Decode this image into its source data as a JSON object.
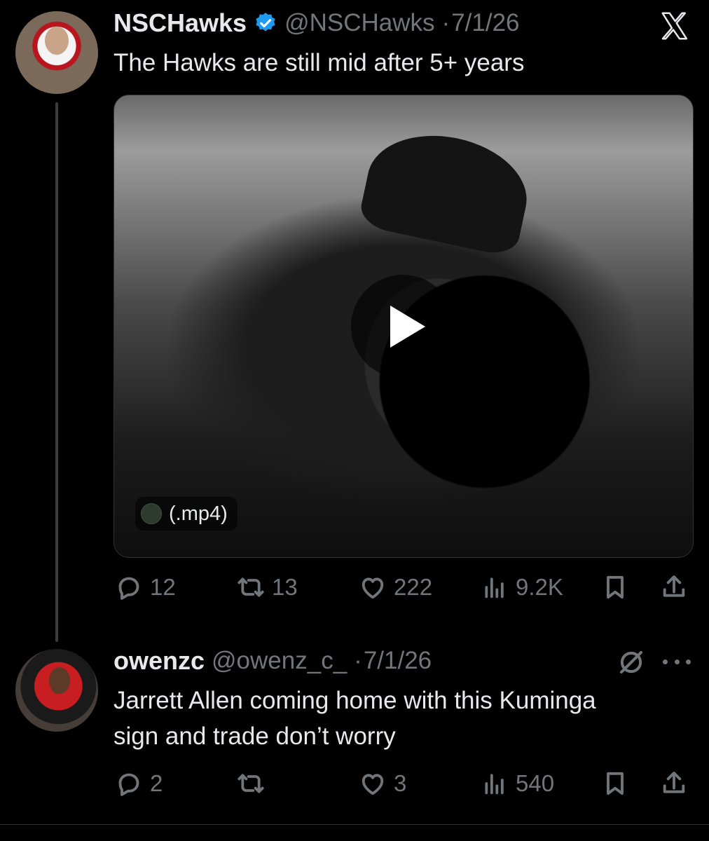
{
  "tweet": {
    "display_name": "NSCHawks",
    "verified": true,
    "handle": "@NSCHawks",
    "date": "7/1/26",
    "text": "The Hawks are still mid after 5+ years",
    "media": {
      "tag_label": "(.mp4)",
      "icon": "play-icon"
    },
    "actions": {
      "replies": "12",
      "reposts": "13",
      "likes": "222",
      "views": "9.2K"
    }
  },
  "reply": {
    "display_name": "owenzc",
    "handle": "@owenz_c_",
    "date": "7/1/26",
    "text_line1": "Jarrett Allen coming home with this Kuminga",
    "text_line2": "sign and trade don’t worry",
    "actions": {
      "replies": "2",
      "reposts": "",
      "likes": "3",
      "views": "540"
    }
  },
  "colors": {
    "background": "#000000",
    "text": "#e7e9ea",
    "muted": "#71767b",
    "verified": "#1d9bf0"
  },
  "icons": [
    "x-logo-icon",
    "verified-badge-icon",
    "reply-icon",
    "repost-icon",
    "like-icon",
    "views-icon",
    "bookmark-icon",
    "share-icon",
    "grok-icon",
    "more-icon"
  ]
}
